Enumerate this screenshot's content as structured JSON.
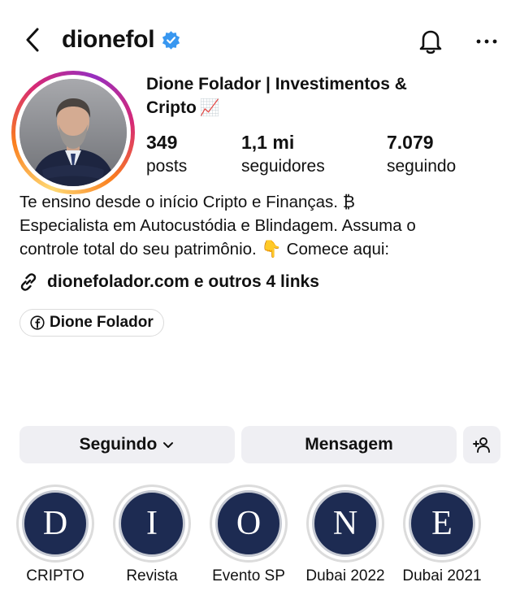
{
  "header": {
    "username": "dionefol"
  },
  "profile": {
    "display_name": "Dione Folador | Investimentos & Cripto",
    "display_name_line1": "Dione Folador | Investimentos &",
    "display_name_line2": "Cripto",
    "name_emoji": "📈",
    "stats": [
      {
        "value": "349",
        "label": "posts"
      },
      {
        "value": "1,1 mi",
        "label": "seguidores"
      },
      {
        "value": "7.079",
        "label": "seguindo"
      }
    ],
    "bio_lines": [
      "Te ensino desde o início Cripto e Finanças. ₿",
      "Especialista em Autocustódia e Blindagem. Assuma o",
      "controle total do seu patrimônio. 👇 Comece aqui:"
    ],
    "link_text": "dionefolador.com e outros 4 links",
    "facebook_chip": "Dione Folador"
  },
  "actions": {
    "following_label": "Seguindo",
    "message_label": "Mensagem"
  },
  "highlights": [
    {
      "letter": "D",
      "label": "CRIPTO"
    },
    {
      "letter": "I",
      "label": "Revista"
    },
    {
      "letter": "O",
      "label": "Evento SP"
    },
    {
      "letter": "N",
      "label": "Dubai 2022"
    },
    {
      "letter": "E",
      "label": "Dubai 2021"
    }
  ],
  "colors": {
    "verified_blue": "#3897f0",
    "button_bg": "#efeff3",
    "highlight_navy": "#1d2b52"
  }
}
